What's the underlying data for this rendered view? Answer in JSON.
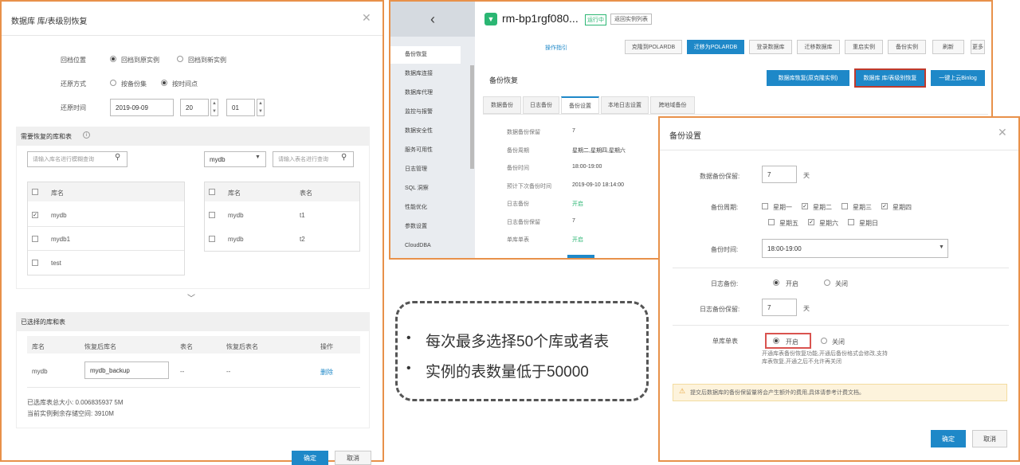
{
  "left_dialog": {
    "title": "数据库 库/表级别恢复",
    "restore_location_label": "回档位置",
    "restore_location_opts": [
      "回档到原实例",
      "回档到新实例"
    ],
    "restore_method_label": "还原方式",
    "restore_method_opts": [
      "按备份集",
      "按时间点"
    ],
    "restore_time_label": "还原时间",
    "date_value": "2019-09-09",
    "hour_value": "20",
    "minute_value": "01",
    "section1_title": "需要恢复的库和表",
    "db_search_placeholder": "请输入库名进行模糊查询",
    "db_select_value": "mydb",
    "table_search_placeholder": "请输入表名进行查询",
    "db_col": "库名",
    "dbs": [
      {
        "name": "mydb",
        "checked": true
      },
      {
        "name": "mydb1",
        "checked": false
      },
      {
        "name": "test",
        "checked": false
      }
    ],
    "tbl_cols": [
      "库名",
      "表名"
    ],
    "tables": [
      {
        "db": "mydb",
        "table": "t1"
      },
      {
        "db": "mydb",
        "table": "t2"
      }
    ],
    "section2_title": "已选择的库和表",
    "sel_cols": [
      "库名",
      "恢复后库名",
      "表名",
      "恢复后表名",
      "操作"
    ],
    "sel_row": {
      "db": "mydb",
      "new_db": "mydb_backup",
      "table": "--",
      "new_table": "--",
      "op": "删除"
    },
    "size_line": "已选库表总大小: 0.006835937 5M",
    "storage_line": "当前实例剩余存储空间: 3910M",
    "ok": "确定",
    "cancel": "取消"
  },
  "middle_console": {
    "instance_name": "rm-bp1rgf080...",
    "status": "运行中",
    "return_btn": "返回实例列表",
    "toolbar": [
      "操作指引",
      "克隆到POLARDB",
      "迁移为POLARDB",
      "登录数据库",
      "迁移数据库",
      "重启实例",
      "备份实例",
      "刷新",
      "更多"
    ],
    "section_title": "备份恢复",
    "action_buttons": [
      "数据库恢复(原克隆实例)",
      "数据库 库/表级别恢复",
      "一键上云Binlog"
    ],
    "tabs": [
      "数据备份",
      "日志备份",
      "备份设置",
      "本地日志设置",
      "跨地域备份"
    ],
    "sidebar": [
      "备份恢复",
      "数据库连接",
      "数据库代理",
      "监控与报警",
      "数据安全性",
      "服务可用性",
      "日志管理",
      "SQL 洞察",
      "性能优化",
      "参数设置",
      "CloudDBA"
    ],
    "settings": [
      {
        "k": "数据备份保留",
        "v": "7"
      },
      {
        "k": "备份周期",
        "v": "星期二,星期四,星期六"
      },
      {
        "k": "备份时间",
        "v": "18:00-19:00"
      },
      {
        "k": "预计下次备份时间",
        "v": "2019-09-10 18:14:00"
      },
      {
        "k": "日志备份",
        "v": "开启"
      },
      {
        "k": "日志备份保留",
        "v": "7"
      },
      {
        "k": "单库单表",
        "v": "开启"
      }
    ]
  },
  "callout": {
    "bullets": [
      "每次最多选择50个库或者表",
      "实例的表数量低于50000"
    ]
  },
  "right_dialog": {
    "title": "备份设置",
    "retention_label": "数据备份保留:",
    "retention_value": "7",
    "days_unit": "天",
    "cycle_label": "备份周期:",
    "weekdays": [
      {
        "d": "星期一",
        "c": false
      },
      {
        "d": "星期二",
        "c": true
      },
      {
        "d": "星期三",
        "c": false
      },
      {
        "d": "星期四",
        "c": true
      },
      {
        "d": "星期五",
        "c": false
      },
      {
        "d": "星期六",
        "c": true
      },
      {
        "d": "星期日",
        "c": false
      }
    ],
    "time_label": "备份时间:",
    "time_value": "18:00-19:00",
    "log_label": "日志备份:",
    "on": "开启",
    "off": "关闭",
    "log_retention_label": "日志备份保留:",
    "log_retention_value": "7",
    "single_label": "单库单表",
    "single_desc": "开通库表备份恢复功能,开通后备份格式会修改,支持库表恢复,开通之后不允许再关闭",
    "warning": "提交后数据库的备份保留量将会产生额外的费用,具体请参考计费文档。",
    "ok": "确定",
    "cancel": "取消"
  }
}
